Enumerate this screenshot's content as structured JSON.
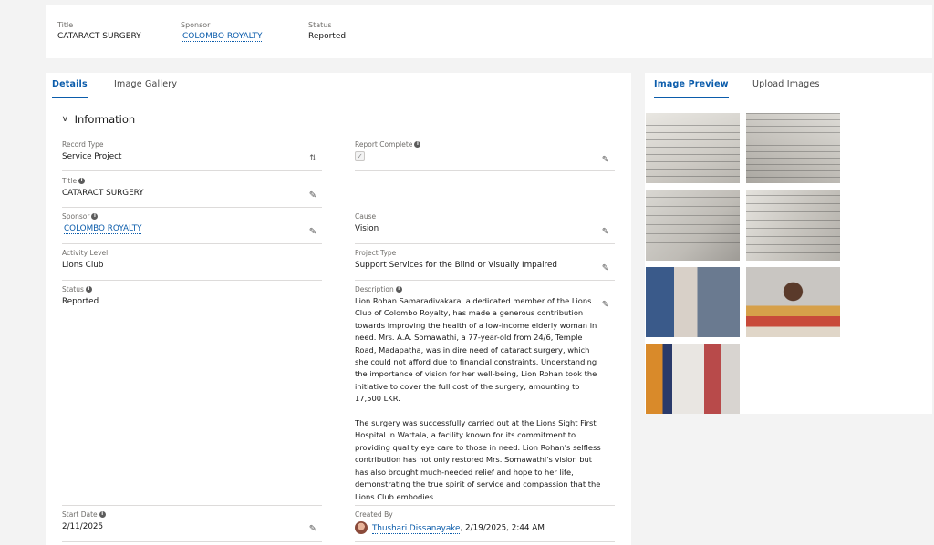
{
  "header": {
    "title_label": "Title",
    "title_value": "CATARACT SURGERY",
    "sponsor_label": "Sponsor",
    "sponsor_value": "COLOMBO ROYALTY",
    "status_label": "Status",
    "status_value": "Reported"
  },
  "left_tabs": [
    "Details",
    "Image Gallery"
  ],
  "right_tabs": [
    "Image Preview",
    "Upload Images"
  ],
  "section_title": "Information",
  "fields": {
    "record_type": {
      "label": "Record Type",
      "value": "Service Project"
    },
    "report_complete": {
      "label": "Report Complete",
      "value": "✓"
    },
    "title": {
      "label": "Title",
      "value": "CATARACT SURGERY"
    },
    "sponsor": {
      "label": "Sponsor",
      "value": "COLOMBO ROYALTY"
    },
    "cause": {
      "label": "Cause",
      "value": "Vision"
    },
    "activity_level": {
      "label": "Activity Level",
      "value": "Lions Club"
    },
    "project_type": {
      "label": "Project Type",
      "value": "Support Services for the Blind or Visually Impaired"
    },
    "status": {
      "label": "Status",
      "value": "Reported"
    },
    "description": {
      "label": "Description",
      "value": "Lion Rohan Samaradivakara, a dedicated member of the Lions Club of Colombo Royalty, has made a generous contribution towards improving the health of a low-income elderly woman in need. Mrs. A.A. Somawathi, a 77-year-old from 24/6, Temple Road, Madapatha, was in dire need of cataract surgery, which she could not afford due to financial constraints. Understanding the importance of vision for her well-being, Lion Rohan took the initiative to cover the full cost of the surgery, amounting to 17,500 LKR.\n\nThe surgery was successfully carried out at the Lions Sight First Hospital in Wattala, a facility known for its commitment to providing quality eye care to those in need. Lion Rohan's selfless contribution has not only restored Mrs. Somawathi's vision but has also brought much-needed relief and hope to her life, demonstrating the true spirit of service and compassion that the Lions Club embodies."
    },
    "start_date": {
      "label": "Start Date",
      "value": "2/11/2025"
    },
    "created_by": {
      "label": "Created By",
      "user": "Thushari Dissanayake",
      "timestamp": ", 2/19/2025, 2:44 AM"
    }
  },
  "gallery_images": [
    "document-photo-1",
    "document-photo-2",
    "document-photo-3",
    "document-photo-4",
    "collage-photo",
    "patient-photo",
    "doctor-visit-photo"
  ],
  "colors": {
    "accent": "#0b5cab",
    "background": "#f3f3f3"
  }
}
